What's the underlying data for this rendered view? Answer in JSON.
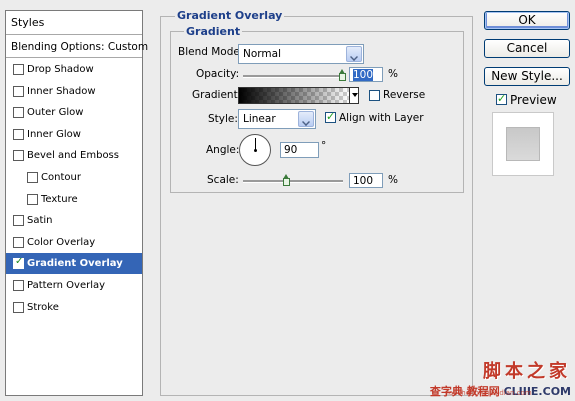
{
  "styles_panel": {
    "header": "Styles",
    "blending_options": "Blending Options: Custom",
    "items": [
      {
        "label": "Drop Shadow",
        "checked": false,
        "indent": false,
        "selected": false
      },
      {
        "label": "Inner Shadow",
        "checked": false,
        "indent": false,
        "selected": false
      },
      {
        "label": "Outer Glow",
        "checked": false,
        "indent": false,
        "selected": false
      },
      {
        "label": "Inner Glow",
        "checked": false,
        "indent": false,
        "selected": false
      },
      {
        "label": "Bevel and Emboss",
        "checked": false,
        "indent": false,
        "selected": false
      },
      {
        "label": "Contour",
        "checked": false,
        "indent": true,
        "selected": false
      },
      {
        "label": "Texture",
        "checked": false,
        "indent": true,
        "selected": false
      },
      {
        "label": "Satin",
        "checked": false,
        "indent": false,
        "selected": false
      },
      {
        "label": "Color Overlay",
        "checked": false,
        "indent": false,
        "selected": false
      },
      {
        "label": "Gradient Overlay",
        "checked": true,
        "indent": false,
        "selected": true
      },
      {
        "label": "Pattern Overlay",
        "checked": false,
        "indent": false,
        "selected": false
      },
      {
        "label": "Stroke",
        "checked": false,
        "indent": false,
        "selected": false
      }
    ]
  },
  "gradient_overlay": {
    "group_title": "Gradient Overlay",
    "sub_title": "Gradient",
    "blend_mode_label": "Blend Mode:",
    "blend_mode_value": "Normal",
    "opacity_label": "Opacity:",
    "opacity_value": "100",
    "opacity_fraction": 1.0,
    "percent_sign": "%",
    "gradient_label": "Gradient:",
    "reverse_label": "Reverse",
    "reverse_checked": false,
    "style_label": "Style:",
    "style_value": "Linear",
    "align_label": "Align with Layer",
    "align_checked": true,
    "angle_label": "Angle:",
    "angle_value": "90",
    "degree_sign": "°",
    "scale_label": "Scale:",
    "scale_value": "100",
    "scale_fraction": 0.44
  },
  "buttons": {
    "ok": "OK",
    "cancel": "Cancel",
    "new_style": "New Style...",
    "preview_label": "Preview",
    "preview_checked": true
  },
  "watermark": {
    "chinese": "脚本之家",
    "site_cn": "查字典 教程网",
    "site_en": "CLIIIE.COM",
    "url": "jiaocheng.chazidian.com"
  },
  "colors": {
    "selected_bg": "#3465b6",
    "title_blue": "#1d3f8a",
    "check_green": "#21a121",
    "watermark_red": "#c23a2a"
  }
}
